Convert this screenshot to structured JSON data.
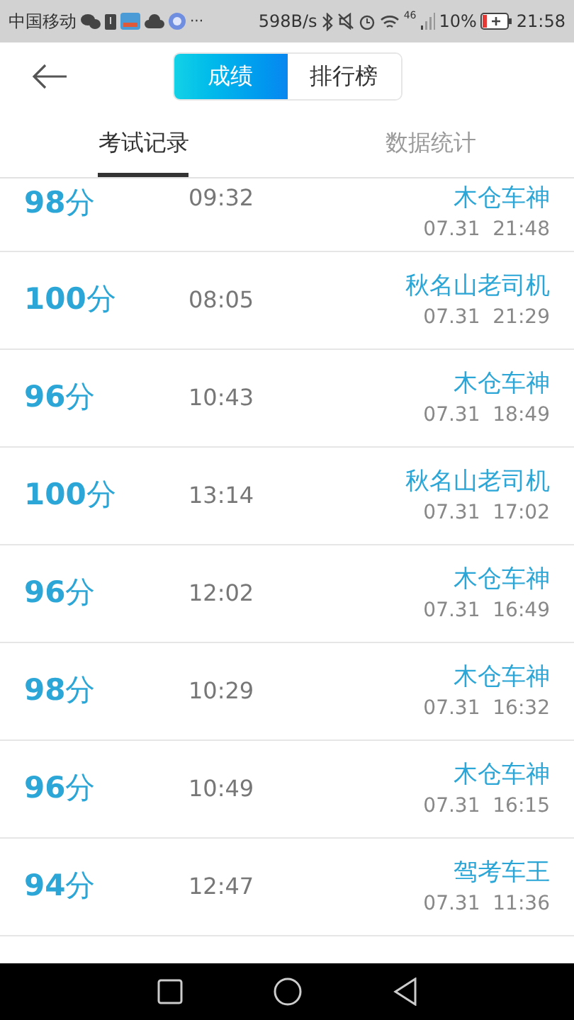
{
  "status_bar": {
    "carrier": "中国移动",
    "more": "···",
    "speed": "598B/s",
    "network": "46",
    "battery": "10%",
    "time": "21:58"
  },
  "header": {
    "segments": [
      {
        "label": "成绩",
        "selected": true
      },
      {
        "label": "排行榜",
        "selected": false
      }
    ]
  },
  "tabs": [
    {
      "label": "考试记录",
      "selected": true
    },
    {
      "label": "数据统计",
      "selected": false
    }
  ],
  "records": [
    {
      "score": "**98**分",
      "duration": "09:32",
      "name": "木仓车神",
      "date": "07.31  21:48"
    },
    {
      "score": "**100**分",
      "duration": "08:05",
      "name": "秋名山老司机",
      "date": "07.31  21:29"
    },
    {
      "score": "**96**分",
      "duration": "10:43",
      "name": "木仓车神",
      "date": "07.31  18:49"
    },
    {
      "score": "**100**分",
      "duration": "13:14",
      "name": "秋名山老司机",
      "date": "07.31  17:02"
    },
    {
      "score": "**96**分",
      "duration": "12:02",
      "name": "木仓车神",
      "date": "07.31  16:49"
    },
    {
      "score": "**98**分",
      "duration": "10:29",
      "name": "木仓车神",
      "date": "07.31  16:32"
    },
    {
      "score": "**96**分",
      "duration": "10:49",
      "name": "木仓车神",
      "date": "07.31  16:15"
    },
    {
      "score": "**94**分",
      "duration": "12:47",
      "name": "驾考车王",
      "date": "07.31  11:36"
    }
  ]
}
